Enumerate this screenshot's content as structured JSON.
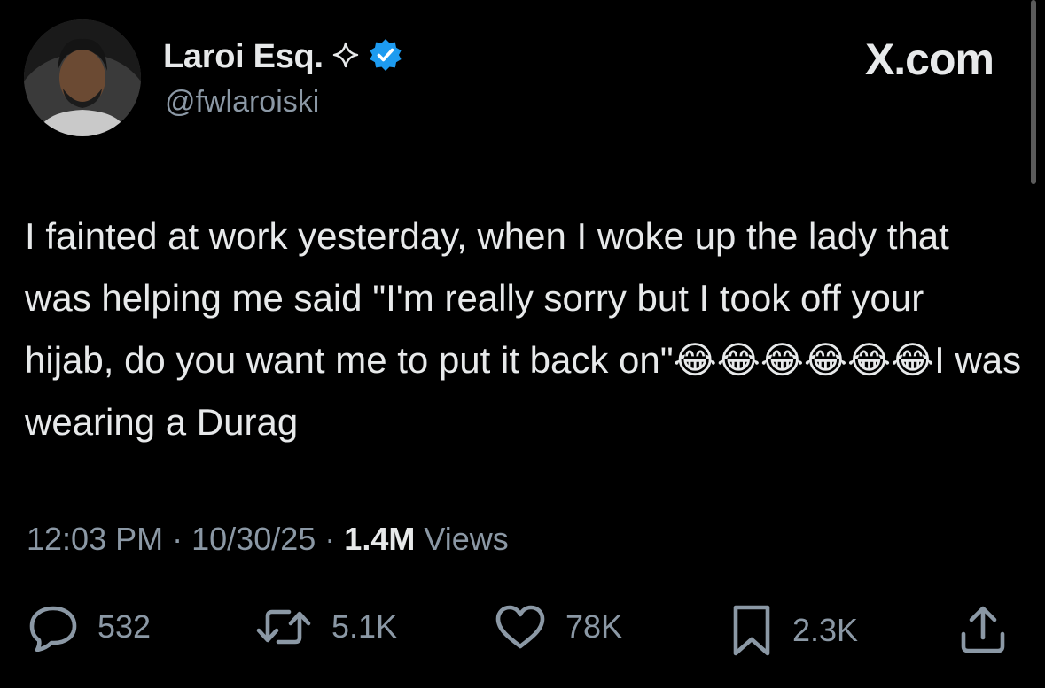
{
  "author": {
    "display_name": "Laroi Esq.",
    "handle": "@fwlaroiski",
    "verified_icon": "verified-badge-icon",
    "sparkle_icon": "sparkle-icon"
  },
  "brand": {
    "text": "X.com"
  },
  "tweet": {
    "text": "I fainted at work yesterday, when I woke up the lady that was helping me said \"I'm really sorry but I took off your hijab, do you want me to put it back on\"😂😂😂😂😂😂I was wearing a Durag"
  },
  "meta": {
    "time": "12:03 PM",
    "separator": "·",
    "date": "10/30/25",
    "views_count": "1.4M",
    "views_label": "Views"
  },
  "actions": {
    "replies": "532",
    "reposts": "5.1K",
    "likes": "78K",
    "bookmarks": "2.3K"
  },
  "colors": {
    "background": "#000000",
    "text": "#e7e9ea",
    "secondary": "#8b98a5",
    "verified": "#1d9bf0"
  }
}
